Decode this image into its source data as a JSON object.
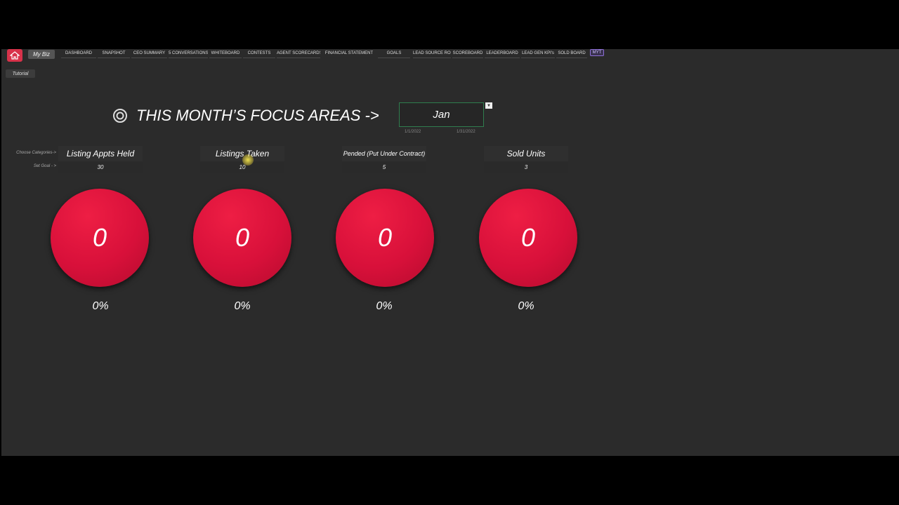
{
  "nav": {
    "mybiz": "My Biz",
    "tabs": [
      {
        "label": "DASHBOARD"
      },
      {
        "label": "SNAPSHOT"
      },
      {
        "label": "CEO SUMMARY"
      },
      {
        "label": "5 CONVERSATIONS"
      },
      {
        "label": "WHITEBOARD"
      },
      {
        "label": "CONTESTS"
      },
      {
        "label": "AGENT SCORECARDS"
      },
      {
        "label": "FINANCIAL STATEMENT"
      },
      {
        "label": "GOALS"
      },
      {
        "label": "LEAD SOURCE ROI"
      },
      {
        "label": "SCOREBOARD"
      },
      {
        "label": "LEADERBOARD"
      },
      {
        "label": "LEAD GEN KPI's"
      },
      {
        "label": "SOLD BOARD"
      },
      {
        "label": "MYT"
      }
    ],
    "tutorial": "Tutorial"
  },
  "focus": {
    "title": "THIS MONTH’S FOCUS AREAS ->",
    "month": "Jan",
    "start_date": "1/1/2022",
    "end_date": "1/31/2022"
  },
  "labels": {
    "choose": "Choose Categories->",
    "goal": "Set Goal - >"
  },
  "categories": [
    {
      "name": "Listing Appts Held",
      "goal": "30",
      "count": "0",
      "pct": "0%"
    },
    {
      "name": "Listings Taken",
      "goal": "10",
      "count": "0",
      "pct": "0%"
    },
    {
      "name": "Pended (Put Under Contract)",
      "goal": "5",
      "count": "0",
      "pct": "0%"
    },
    {
      "name": "Sold Units",
      "goal": "3",
      "count": "0",
      "pct": "0%"
    }
  ],
  "colors": {
    "circle": "#d8103a",
    "background": "#2b2b2b",
    "accent_border": "#2f7d4e"
  }
}
